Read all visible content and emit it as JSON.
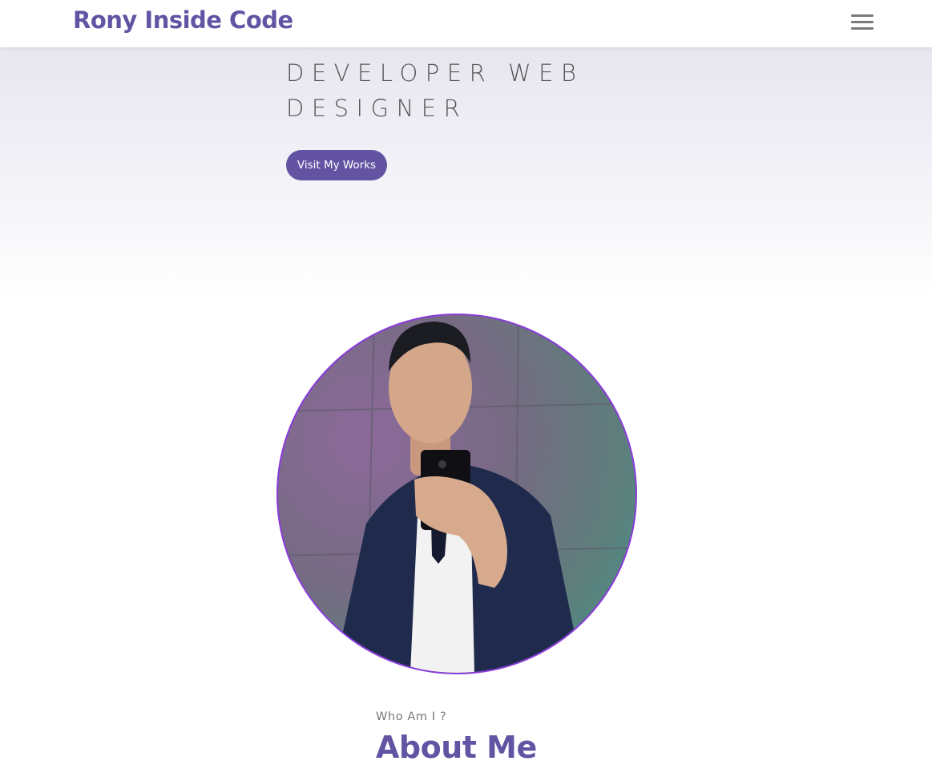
{
  "navbar": {
    "brand": "Rony Inside Code",
    "menu_icon": "hamburger-menu-icon"
  },
  "hero": {
    "tagline": "DEVELOPER WEB DESIGNER",
    "cta_label": "Visit My Works"
  },
  "profile": {
    "photo": "profile-photo"
  },
  "about": {
    "eyebrow": "Who Am I ?",
    "title": "About Me"
  },
  "colors": {
    "brand": "#6353a3",
    "photo_ring": "#8a3bdb",
    "hero_bg_top": "#e7e6ef",
    "text_muted": "#777777"
  }
}
